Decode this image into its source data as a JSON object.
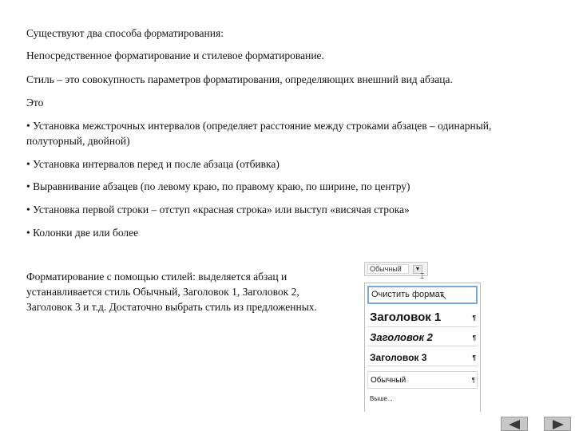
{
  "paragraphs": [
    "Существуют два способа форматирования:",
    "Непосредственное форматирование и стилевое форматирование.",
    "Стиль – это совокупность параметров форматирования, определяющих внешний вид абзаца.",
    "Это",
    "• Установка межстрочных интервалов (определяет расстояние между строками абзацев – одинарный, полуторный, двойной)",
    "• Установка интервалов перед и после абзаца (отбивка)",
    "• Выравнивание абзацев (по левому краю, по правому краю, по ширине, по центру)",
    "• Установка первой строки – отступ «красная строка» или выступ «висячая строка»",
    "• Колонки две или более",
    "Форматирование с помощью стилей: выделяется абзац и устанавливается стиль Обычный, Заголовок 1, Заголовок 2, Заголовок 3 и т.д. Достаточно выбрать стиль из предложенных."
  ],
  "style_picker": {
    "current": "Обычный",
    "items": [
      {
        "label": "Очистить формат",
        "mark": ""
      },
      {
        "label": "Заголовок 1",
        "mark": "¶"
      },
      {
        "label": "Заголовок 2",
        "mark": "¶"
      },
      {
        "label": "Заголовок 3",
        "mark": "¶"
      },
      {
        "label": "Обычный",
        "mark": "¶"
      },
      {
        "label": "Выше...",
        "mark": ""
      }
    ]
  },
  "navigation": {
    "prev": "previous-arrow-icon",
    "next": "next-arrow-icon"
  }
}
